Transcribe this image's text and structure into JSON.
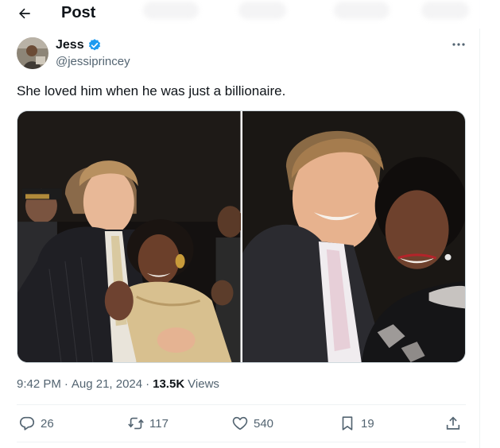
{
  "header": {
    "title": "Post"
  },
  "author": {
    "name": "Jess",
    "handle": "@jessiprincey"
  },
  "tweet": {
    "text": "She loved him when he was just a billionaire."
  },
  "meta": {
    "time": "9:42 PM",
    "sep1": "·",
    "date": "Aug 21, 2024",
    "sep2": "·",
    "views_count": "13.5K",
    "views_label": "Views"
  },
  "actions": {
    "replies": "26",
    "reposts": "117",
    "likes": "540",
    "bookmarks": "19"
  },
  "icons": [
    "back-arrow-icon",
    "verified-badge-icon",
    "more-icon",
    "reply-icon",
    "repost-icon",
    "like-icon",
    "bookmark-icon",
    "share-icon"
  ],
  "colors": {
    "verified": "#1d9bf0",
    "secondary_text": "#536471",
    "primary_text": "#0f1419"
  }
}
